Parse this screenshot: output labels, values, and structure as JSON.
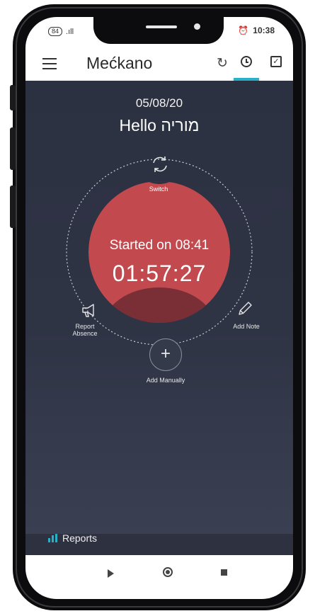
{
  "status_bar": {
    "battery": "84",
    "signal": ".ıll",
    "alarm_icon": "alarm-icon",
    "time": "10:38"
  },
  "app_bar": {
    "title": "Mećkano",
    "icons": [
      "menu-icon",
      "refresh-icon",
      "clock-icon",
      "checkbox-icon"
    ],
    "accent": "#28b0c8"
  },
  "main": {
    "date": "05/08/20",
    "greeting": "Hello מוריה",
    "switch_label": "Switch",
    "started_text": "Started on 08:41",
    "elapsed_time": "01:57:27",
    "report_absence_label": "Report Absence",
    "add_note_label": "Add Note",
    "add_manually_label": "Add Manually",
    "reports_label": "Reports",
    "dial_color": "#c24a4f"
  },
  "nav_bar": {
    "icons": [
      "back-icon",
      "home-icon",
      "recent-apps-icon"
    ]
  }
}
